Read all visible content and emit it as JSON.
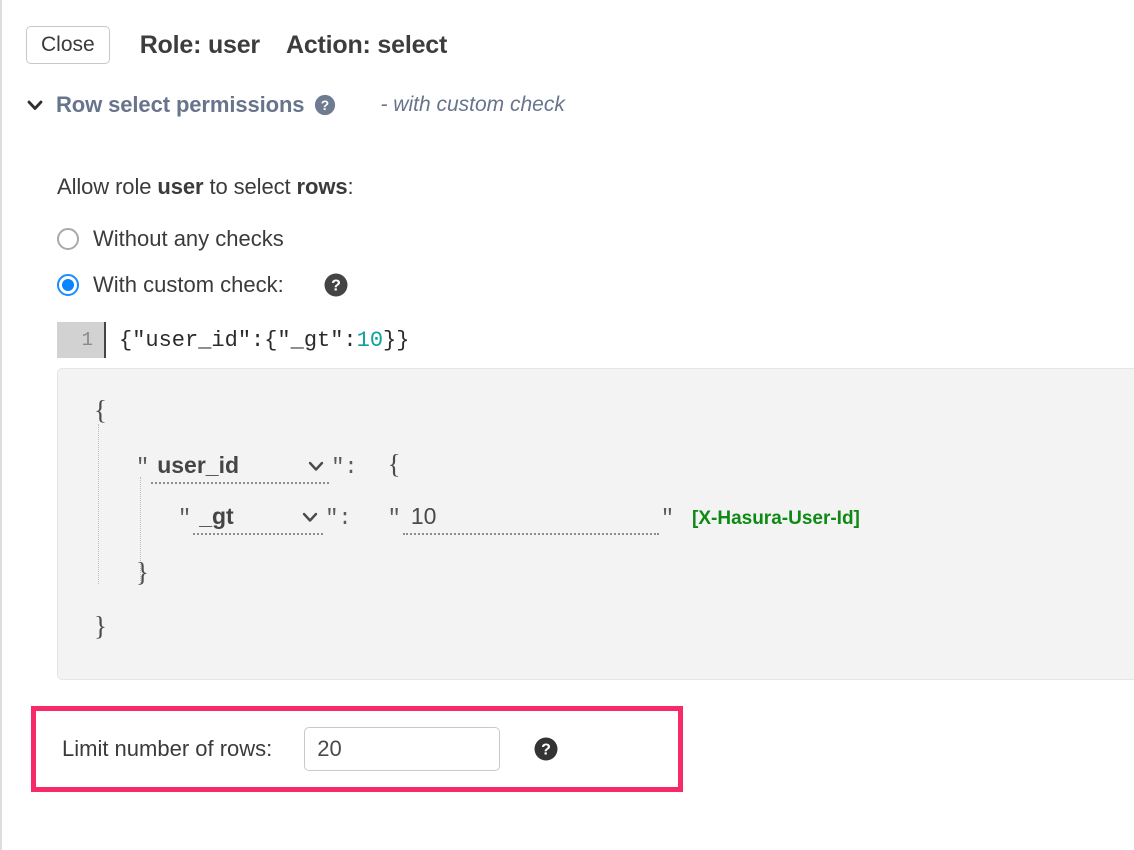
{
  "header": {
    "close_label": "Close",
    "role_text": "Role: user",
    "action_text": "Action: select"
  },
  "section": {
    "title": "Row select permissions",
    "subtitle": "- with custom check",
    "collapse_icon": "chevron-down-icon",
    "help_icon": "help-circle-icon",
    "help_icon_color": "#68748c"
  },
  "permissions": {
    "allow_prefix": "Allow role ",
    "allow_role": "user",
    "allow_middle": " to select ",
    "allow_object": "rows",
    "allow_suffix": ":",
    "options": [
      {
        "label": "Without any checks",
        "selected": false
      },
      {
        "label": "With custom check:",
        "selected": true
      }
    ],
    "selected_option": "With custom check:",
    "custom_check_help_icon": "help-circle-icon"
  },
  "editor": {
    "line_number": "1",
    "code_prefix": "{\"user_id\":{\"_gt\":",
    "code_number": "10",
    "code_suffix": "}}",
    "full_code": "{\"user_id\":{\"_gt\":10}}"
  },
  "builder": {
    "open_brace_outer": "{",
    "close_brace_outer": "}",
    "open_brace_inner": "{",
    "close_brace_inner": "}",
    "quote": "\"",
    "colon": ":",
    "column_field": "user_id",
    "operator_field": "_gt",
    "value_field": "10",
    "value_hint": "[X-Hasura-User-Id]",
    "value_hint_color": "#0e8a14",
    "caret_icon": "chevron-down-icon"
  },
  "limit": {
    "label": "Limit number of rows:",
    "value": "20",
    "placeholder": "",
    "help_icon": "help-circle-icon",
    "highlight_color": "#f72a67"
  }
}
